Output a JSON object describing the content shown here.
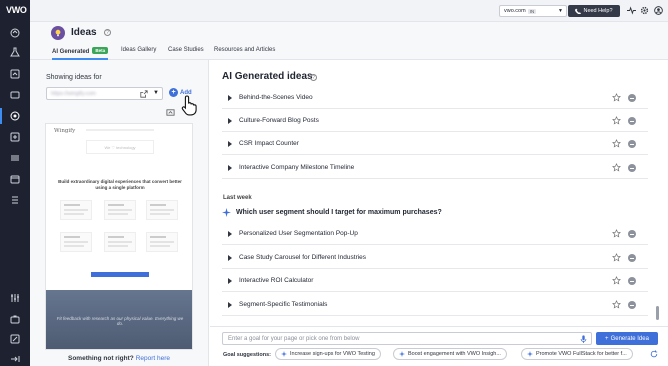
{
  "brand": {
    "logo_text": "VWO"
  },
  "topbar": {
    "domain": "vwo.com",
    "domain_badge": "IN",
    "help_label": "Need Help?"
  },
  "header": {
    "title": "Ideas",
    "tabs": [
      {
        "label": "AI Generated",
        "badge": "Beta",
        "active": true
      },
      {
        "label": "Ideas Gallery"
      },
      {
        "label": "Case Studies"
      },
      {
        "label": "Resources and Articles"
      }
    ]
  },
  "left_panel": {
    "showing_label": "Showing ideas for",
    "url_value": "https://wingify.com",
    "add_label": "Add",
    "preview": {
      "brand": "Wingify",
      "hero_text": "We ♡ technology",
      "headline": "Build extraordinary digital experiences that convert better using a single platform",
      "caption": "Fit feedback with research as our physical value. Everything we do."
    },
    "report_text": "Something not right?",
    "report_link": "Report here"
  },
  "main": {
    "heading": "AI Generated ideas",
    "ideas_top": [
      "Behind-the-Scenes Video",
      "Culture-Forward Blog Posts",
      "CSR Impact Counter",
      "Interactive Company Milestone Timeline"
    ],
    "section_label": "Last week",
    "question": "Which user segment should I target for maximum purchases?",
    "ideas_bottom": [
      "Personalized User Segmentation Pop-Up",
      "Case Study Carousel for Different Industries",
      "Interactive ROI Calculator",
      "Segment-Specific Testimonials"
    ]
  },
  "composer": {
    "placeholder": "Enter a goal for your page or pick one from below",
    "generate_label": "Generate Idea",
    "suggestions_label": "Goal suggestions:",
    "suggestions": [
      "Increase sign-ups for VWO Testing",
      "Boost engagement with VWO Insigh...",
      "Promote VWO FullStack for better f..."
    ]
  },
  "colors": {
    "rail": "#1e2230",
    "accent": "#3f6fd8",
    "beta": "#3aa65a",
    "help_button": "#343a48"
  }
}
